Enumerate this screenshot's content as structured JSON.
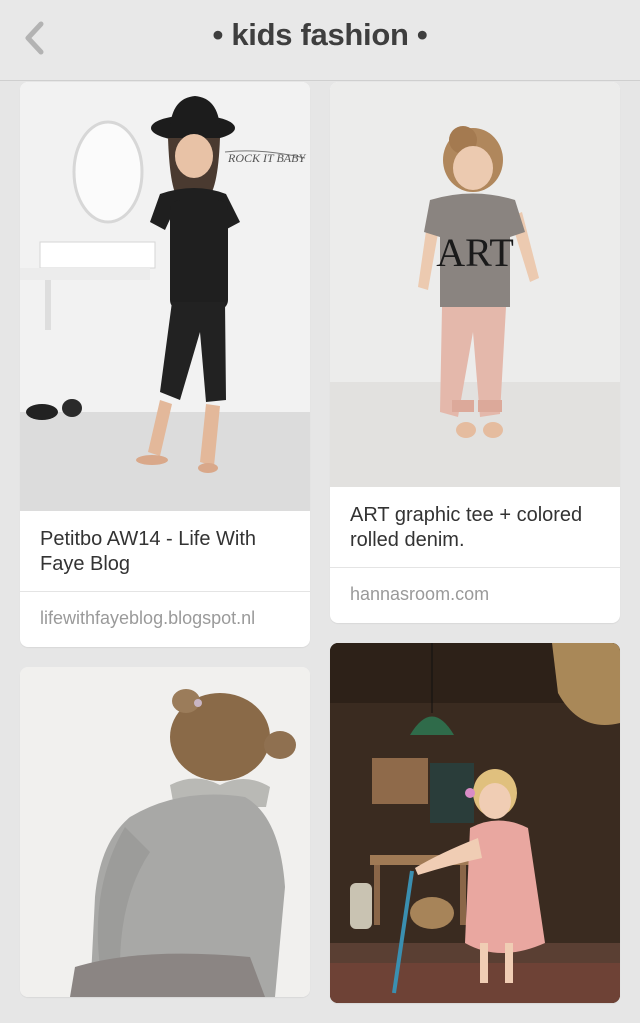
{
  "header": {
    "title": "• kids fashion •",
    "back_icon": "chevron-left-icon"
  },
  "pins": [
    {
      "description": "Petitbo AW14 - Life With Faye Blog",
      "source": "lifewithfayeblog.blogspot.nl",
      "wall_text": "ROCK IT BABY"
    },
    {
      "description": "ART graphic tee + colored rolled denim.",
      "source": "hannasroom.com",
      "shirt_text": "ART"
    },
    {
      "description": "",
      "source": ""
    },
    {
      "description": "",
      "source": ""
    }
  ],
  "colors": {
    "background": "#e6e6e6",
    "card": "#ffffff",
    "title": "#3e3e3e",
    "source_text": "#9a9a9a"
  }
}
